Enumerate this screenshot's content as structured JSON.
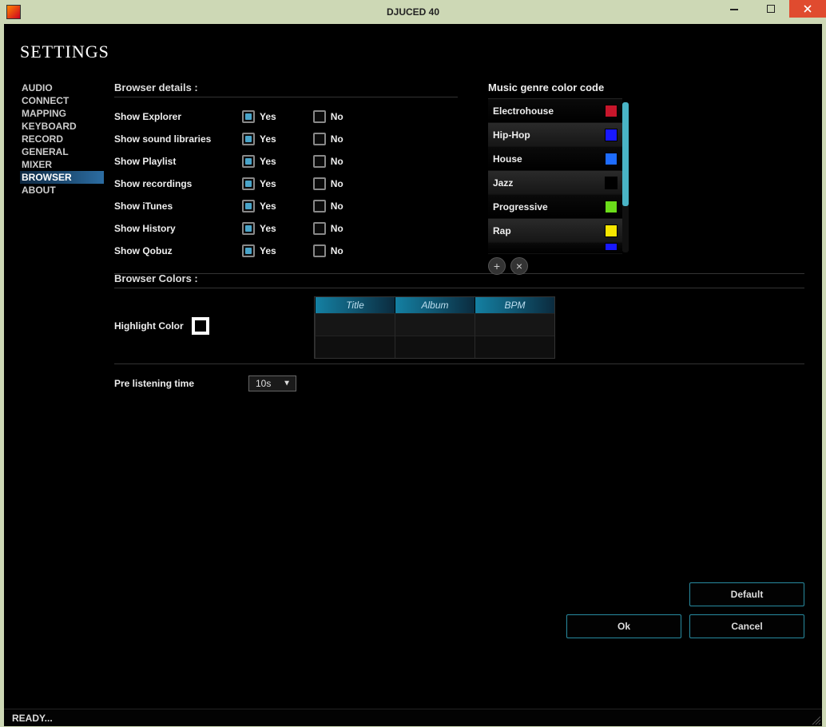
{
  "window": {
    "title": "DJUCED 40"
  },
  "sidebar": {
    "title": "SETTINGS",
    "items": [
      {
        "label": "AUDIO"
      },
      {
        "label": "CONNECT"
      },
      {
        "label": "MAPPING"
      },
      {
        "label": "KEYBOARD"
      },
      {
        "label": "RECORD"
      },
      {
        "label": "GENERAL"
      },
      {
        "label": "MIXER"
      },
      {
        "label": "BROWSER"
      },
      {
        "label": "ABOUT"
      }
    ],
    "active_index": 7
  },
  "browser_details": {
    "title": "Browser details :",
    "yes_label": "Yes",
    "no_label": "No",
    "rows": [
      {
        "label": "Show Explorer",
        "value": true
      },
      {
        "label": "Show sound libraries",
        "value": true
      },
      {
        "label": "Show Playlist",
        "value": true
      },
      {
        "label": "Show recordings",
        "value": true
      },
      {
        "label": "Show iTunes",
        "value": true
      },
      {
        "label": "Show History",
        "value": true
      },
      {
        "label": "Show Qobuz",
        "value": true
      }
    ]
  },
  "genres": {
    "title": "Music genre color code",
    "items": [
      {
        "name": "Electrohouse",
        "color": "#c7162b"
      },
      {
        "name": "Hip-Hop",
        "color": "#1818ff"
      },
      {
        "name": "House",
        "color": "#1e6cff"
      },
      {
        "name": "Jazz",
        "color": "#000000"
      },
      {
        "name": "Progressive",
        "color": "#6bdd1a"
      },
      {
        "name": "Rap",
        "color": "#f7e600"
      },
      {
        "name": "",
        "color": "#1818ff"
      }
    ],
    "add_label": "+",
    "remove_label": "×"
  },
  "browser_colors": {
    "title": "Browser Colors :",
    "highlight_label": "Highlight Color",
    "highlight_color": "#000000",
    "columns": [
      "Title",
      "Album",
      "BPM"
    ]
  },
  "pre_listen": {
    "label": "Pre listening time",
    "value": "10s"
  },
  "buttons": {
    "default": "Default",
    "ok": "Ok",
    "cancel": "Cancel"
  },
  "status": "READY..."
}
